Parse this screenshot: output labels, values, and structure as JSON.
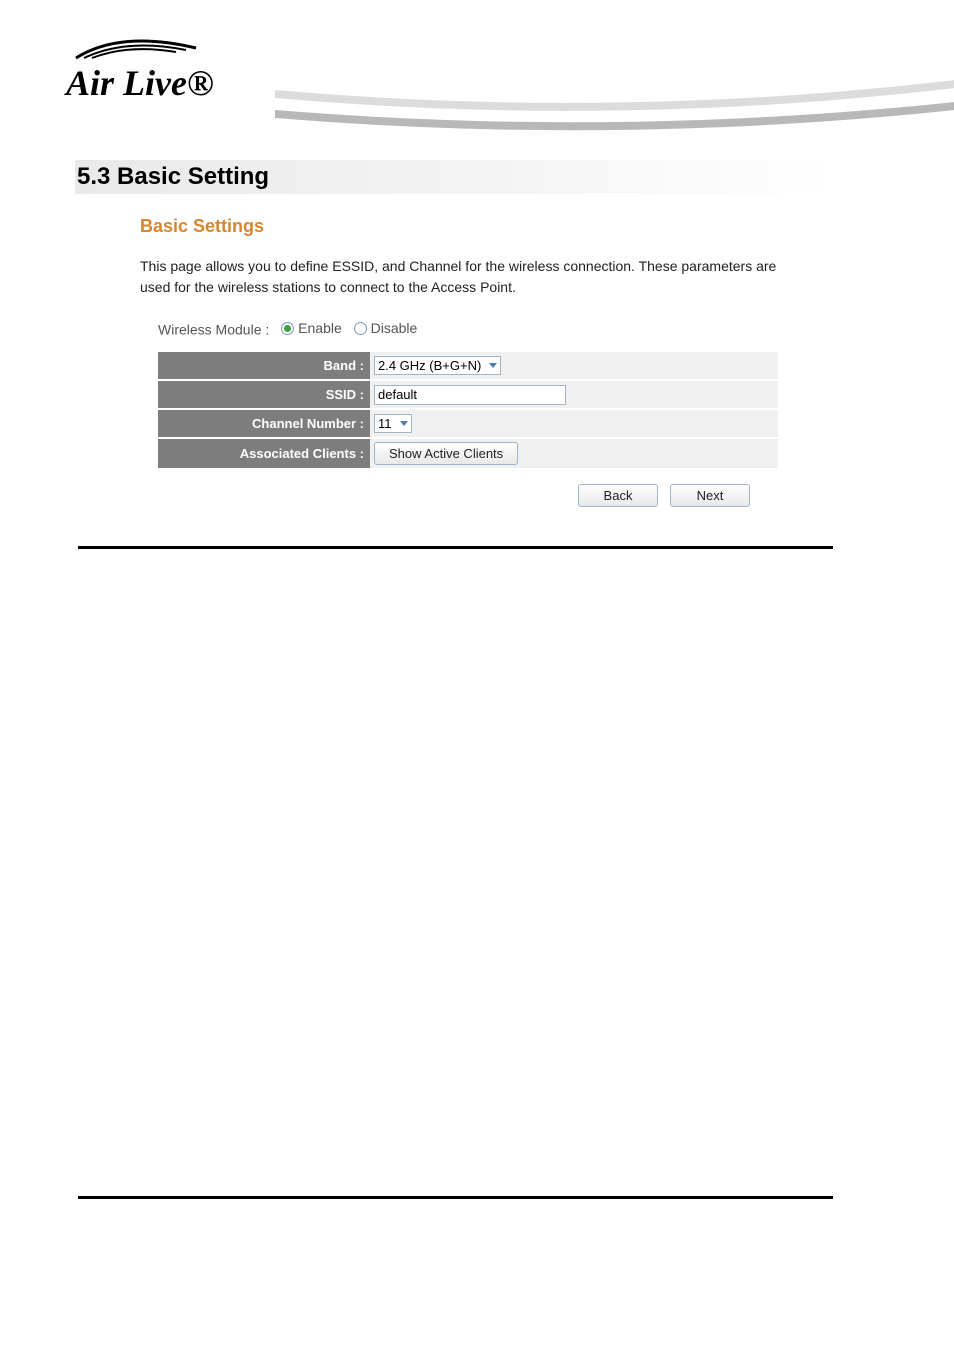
{
  "logo": {
    "text": "Air Live®"
  },
  "heading": "5.3 Basic  Setting",
  "subheading": "Basic Settings",
  "description": "This page allows you to define ESSID, and Channel for the wireless connection. These parameters are used for the wireless stations to connect to the Access Point.",
  "wireless_module": {
    "label": "Wireless Module :",
    "options": [
      "Enable",
      "Disable"
    ],
    "selected": "Enable"
  },
  "rows": {
    "band": {
      "label": "Band :",
      "value": "2.4 GHz (B+G+N)"
    },
    "ssid": {
      "label": "SSID :",
      "value": "default"
    },
    "channel": {
      "label": "Channel Number :",
      "value": "11"
    },
    "clients": {
      "label": "Associated Clients :",
      "button": "Show Active Clients"
    }
  },
  "nav": {
    "back": "Back",
    "next": "Next"
  }
}
